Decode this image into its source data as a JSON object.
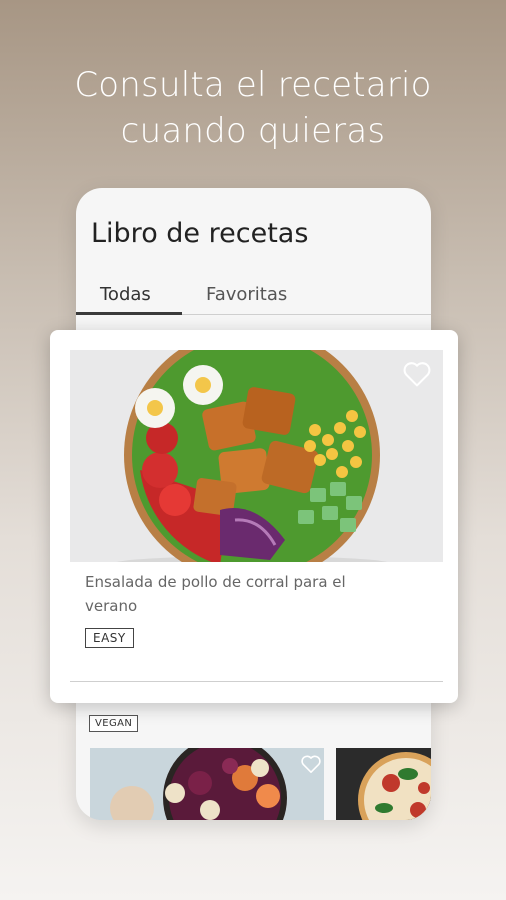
{
  "headline": {
    "line1": "Consulta el recetario",
    "line2": "cuando quieras"
  },
  "phone": {
    "title": "Libro de recetas",
    "tabs": [
      {
        "label": "Todas",
        "active": true
      },
      {
        "label": "Favoritas",
        "active": false
      }
    ]
  },
  "featured_recipe": {
    "title": "Ensalada de pollo de corral para el verano",
    "badge": "EASY",
    "favorite_icon": "heart-outline-icon"
  },
  "next_recipes": {
    "badge": "VEGAN",
    "favorite_icon": "heart-outline-icon"
  },
  "colors": {
    "background_top": "#a79684",
    "background_bottom": "#f5f3f1",
    "tab_indicator": "#3a3a3a",
    "card_background": "#ffffff"
  }
}
